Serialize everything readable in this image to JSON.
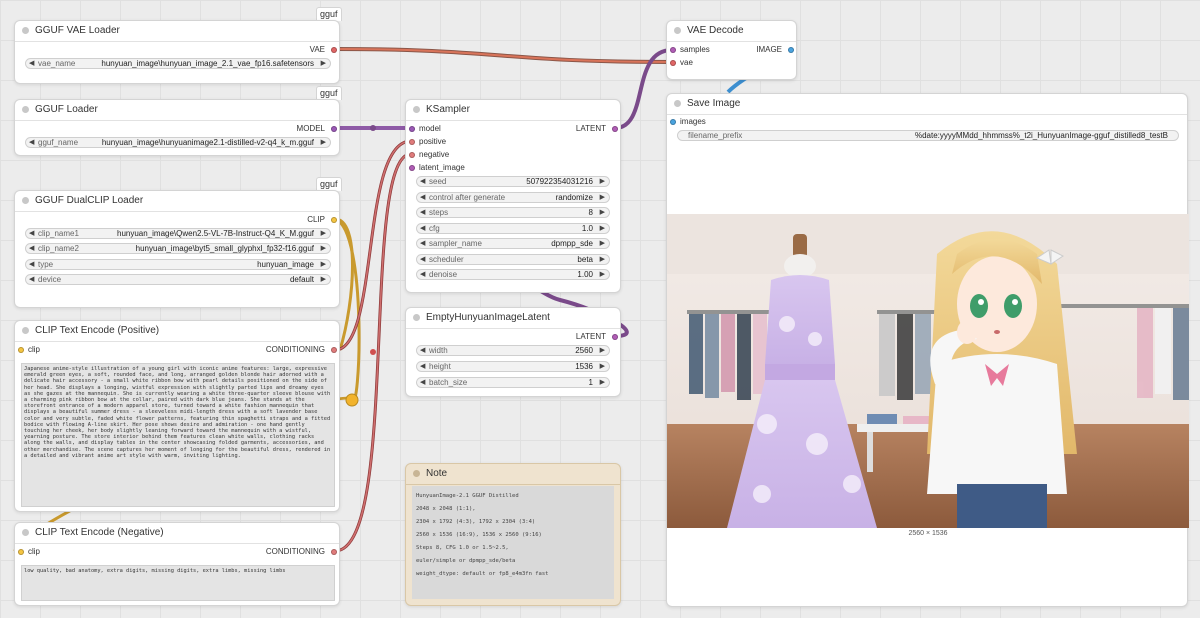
{
  "colors": {
    "vae": "#e06666",
    "model": "#9b59b6",
    "clip": "#f5c542",
    "conditioning": "#e07b7b",
    "latent": "#b05db5",
    "image": "#4aa3df",
    "canvas": "#ececec"
  },
  "vae_loader": {
    "badge": "gguf",
    "title": "GGUF VAE Loader",
    "output": "VAE",
    "widget_label": "vae_name",
    "widget_value": "hunyuan_image\\hunyuan_image_2.1_vae_fp16.safetensors"
  },
  "gguf_loader": {
    "badge": "gguf",
    "title": "GGUF Loader",
    "output": "MODEL",
    "widget_label": "gguf_name",
    "widget_value": "hunyuan_image\\hunyuanimage2.1-distilled-v2-q4_k_m.gguf"
  },
  "dualclip": {
    "badge": "gguf",
    "title": "GGUF DualCLIP Loader",
    "output": "CLIP",
    "widgets": [
      {
        "label": "clip_name1",
        "value": "hunyuan_image\\Qwen2.5-VL-7B-Instruct-Q4_K_M.gguf"
      },
      {
        "label": "clip_name2",
        "value": "hunyuan_image\\byt5_small_glyphxl_fp32-f16.gguf"
      },
      {
        "label": "type",
        "value": "hunyuan_image"
      },
      {
        "label": "device",
        "value": "default"
      }
    ]
  },
  "clip_pos": {
    "title": "CLIP Text Encode (Positive)",
    "input": "clip",
    "output": "CONDITIONING",
    "text": "Japanese anime-style illustration of a young girl with iconic anime features: large, expressive emerald green eyes, a soft, rounded face, and long, arranged golden blonde hair adorned with a delicate hair accessory - a small white ribbon bow with pearl details positioned on the side of her head. She displays a longing, wistful expression with slightly parted lips and dreamy eyes as she gazes at the mannequin. She is currently wearing a white three-quarter sleeve blouse with a charming pink ribbon bow at the collar, paired with dark blue jeans. She stands at the storefront entrance of a modern apparel store, turned toward a white fashion mannequin that displays a beautiful summer dress - a sleeveless midi-length dress with a soft lavender base color and very subtle, faded white flower patterns, featuring thin spaghetti straps and a fitted bodice with flowing A-line skirt. Her pose shows desire and admiration - one hand gently touching her cheek, her body slightly leaning forward toward the mannequin with a wistful, yearning posture. The store interior behind them features clean white walls, clothing racks along the walls, and display tables in the center showcasing folded garments, accessories, and other merchandise. The scene captures her moment of longing for the beautiful dress, rendered in a detailed and vibrant anime art style with warm, inviting lighting."
  },
  "clip_neg": {
    "title": "CLIP Text Encode (Negative)",
    "input": "clip",
    "output": "CONDITIONING",
    "text": "low quality, bad anatomy, extra digits, missing digits, extra limbs, missing limbs"
  },
  "ksampler": {
    "title": "KSampler",
    "inputs": [
      "model",
      "positive",
      "negative",
      "latent_image"
    ],
    "output": "LATENT",
    "widgets": [
      {
        "label": "seed",
        "value": "507922354031216"
      },
      {
        "label": "control after generate",
        "value": "randomize"
      },
      {
        "label": "steps",
        "value": "8"
      },
      {
        "label": "cfg",
        "value": "1.0"
      },
      {
        "label": "sampler_name",
        "value": "dpmpp_sde"
      },
      {
        "label": "scheduler",
        "value": "beta"
      },
      {
        "label": "denoise",
        "value": "1.00"
      }
    ]
  },
  "latent_node": {
    "title": "EmptyHunyuanImageLatent",
    "output": "LATENT",
    "widgets": [
      {
        "label": "width",
        "value": "2560"
      },
      {
        "label": "height",
        "value": "1536"
      },
      {
        "label": "batch_size",
        "value": "1"
      }
    ]
  },
  "note": {
    "title": "Note",
    "lines": [
      "HunyuanImage-2.1 GGUF Distilled",
      "2048 x 2048 (1:1),",
      "2304 x 1792 (4:3),  1792 x 2304 (3:4)",
      "2560 x 1536 (16:9), 1536 x 2560 (9:16)",
      "Steps 8, CFG 1.0 or 1.5~2.5,",
      "euler/simple or dpmpp_sde/beta",
      "weight_dtype: default or fp8_e4m3fn fast"
    ]
  },
  "vae_decode": {
    "title": "VAE Decode",
    "inputs": [
      "samples",
      "vae"
    ],
    "output": "IMAGE"
  },
  "save_image": {
    "title": "Save Image",
    "input": "images",
    "widget_label": "filename_prefix",
    "widget_value": "%date:yyyyMMdd_hhmmss%_t2i_HunyuanImage-gguf_distilled8_testB",
    "caption": "2560 × 1536"
  }
}
